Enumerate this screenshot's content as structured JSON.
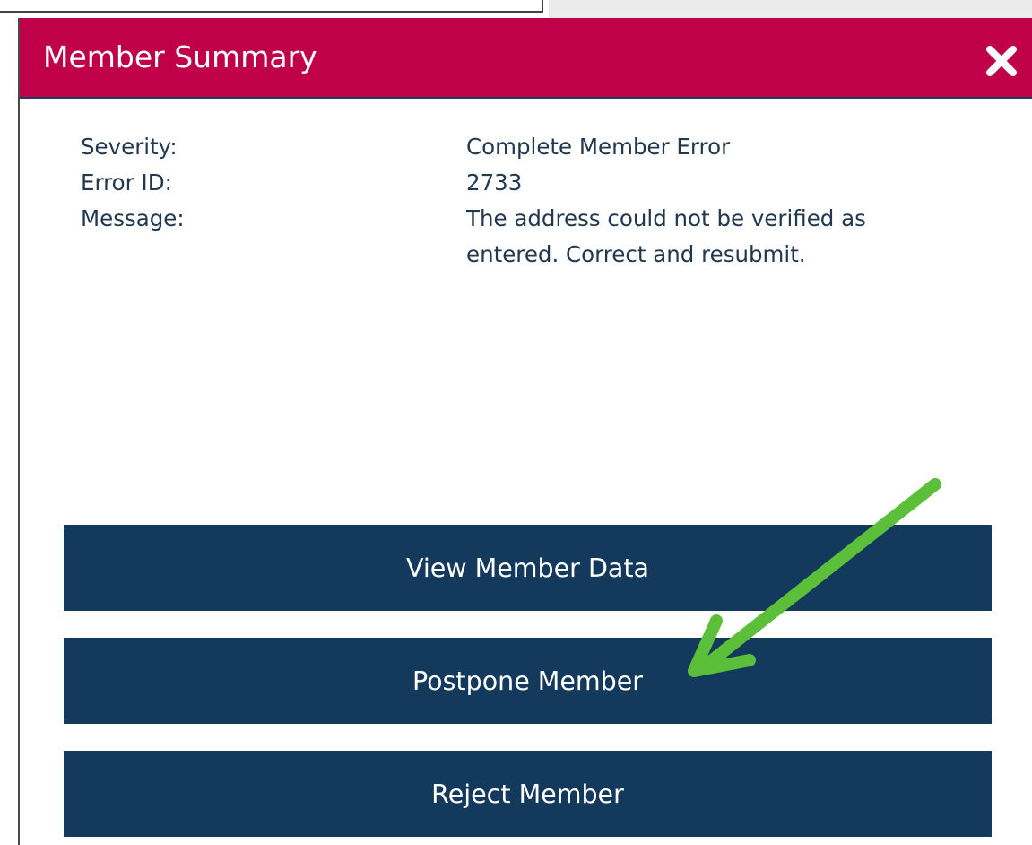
{
  "modal": {
    "title": "Member Summary",
    "close_icon": "close-icon",
    "header_color": "#c00049",
    "details": [
      {
        "label": "Severity:",
        "value": "Complete Member Error"
      },
      {
        "label": "Error ID:",
        "value": "2733"
      },
      {
        "label": "Message:",
        "value": "The address could not be verified as entered. Correct and resubmit."
      }
    ],
    "buttons": {
      "view": "View Member Data",
      "postpone": "Postpone Member",
      "reject": "Reject Member"
    },
    "button_color": "#13395c"
  },
  "annotation": {
    "type": "arrow",
    "color": "#5bbf3a",
    "points_to": "Postpone Member"
  }
}
